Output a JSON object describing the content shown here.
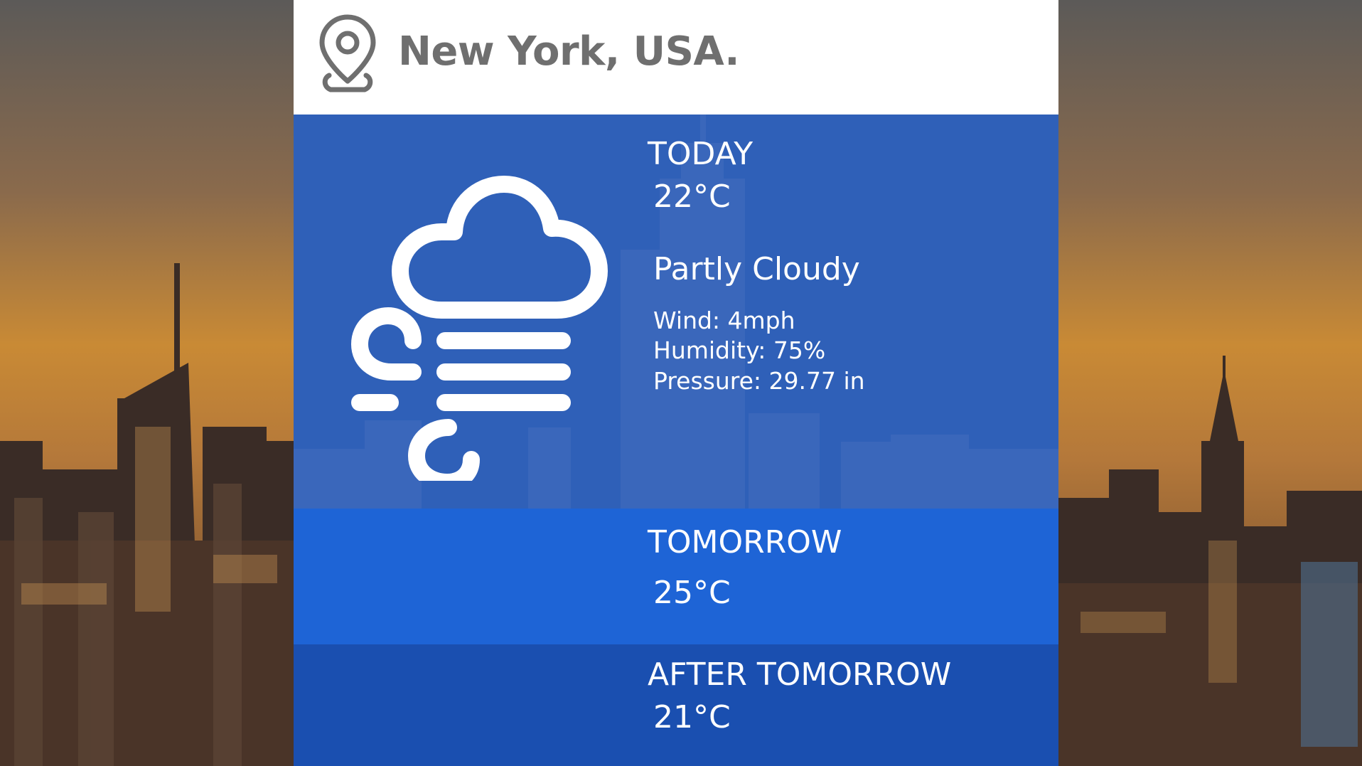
{
  "location": {
    "name": "New York, USA.",
    "icon": "map-pin-icon"
  },
  "today": {
    "label": "TODAY",
    "temperature": "22°C",
    "condition": "Partly Cloudy",
    "condition_icon": "cloud-wind-icon",
    "wind": "Wind: 4mph",
    "humidity": "Humidity: 75%",
    "pressure": "Pressure: 29.77 in"
  },
  "tomorrow": {
    "label": "TOMORROW",
    "temperature": "25°C"
  },
  "after_tomorrow": {
    "label": "AFTER TOMORROW",
    "temperature": "21°C"
  },
  "colors": {
    "header_bg": "#ffffff",
    "city_text": "#6f6f6f",
    "today_bg": "#3060ba",
    "tomorrow_bg": "#1e64d6",
    "after_bg": "#1a4fb0"
  }
}
